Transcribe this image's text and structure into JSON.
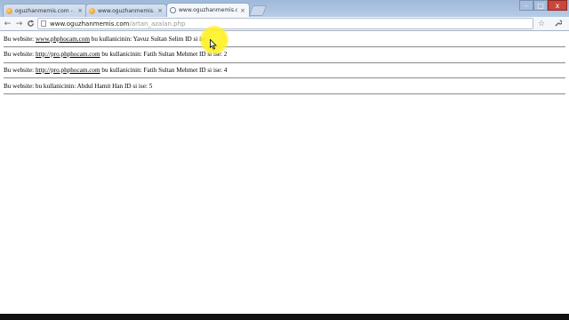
{
  "browser": {
    "tabs": [
      {
        "label": "oguzhanmemis.com - Arc",
        "active": false,
        "icon": "orange-favicon"
      },
      {
        "label": "www.oguzhanmemis.com",
        "active": false,
        "icon": "orange-favicon"
      },
      {
        "label": "www.oguzhanmemis.com/",
        "active": true,
        "icon": "globe-icon"
      }
    ],
    "tab_close_glyph": "×",
    "address_host": "www.oguzhanmemis.com",
    "address_path": "/artan_azalan.php",
    "controls": {
      "minimize": "–",
      "maximize": "□",
      "close": "x"
    },
    "nav": {
      "back": "←",
      "forward": "→",
      "reload": "C"
    },
    "star_glyph": "☆",
    "wrench_glyph": "✎"
  },
  "rows": [
    {
      "prefix": "Bu website: ",
      "link": "www.phphocam.com",
      "suffix": " bu kullanicinin: Yavuz Sultan Selim ID si ise: 1"
    },
    {
      "prefix": "Bu website: ",
      "link": "http://pro.phphocam.com",
      "suffix": " bu kullanicinin: Fatih Sultan Mehmet ID si ise: 2"
    },
    {
      "prefix": "Bu website: ",
      "link": "http://pro.phphocam.com",
      "suffix": " bu kullanicinin: Fatih Sultan Mehmet ID si ise: 4"
    },
    {
      "prefix": "Bu website:  bu kullanicinin: Abdul Hamit Han ID si ise: 5",
      "link": "",
      "suffix": ""
    }
  ],
  "colors": {
    "titlebar": "#9fb9d9",
    "cursor_highlight": "#fff23c",
    "close_button": "#c9463d"
  }
}
